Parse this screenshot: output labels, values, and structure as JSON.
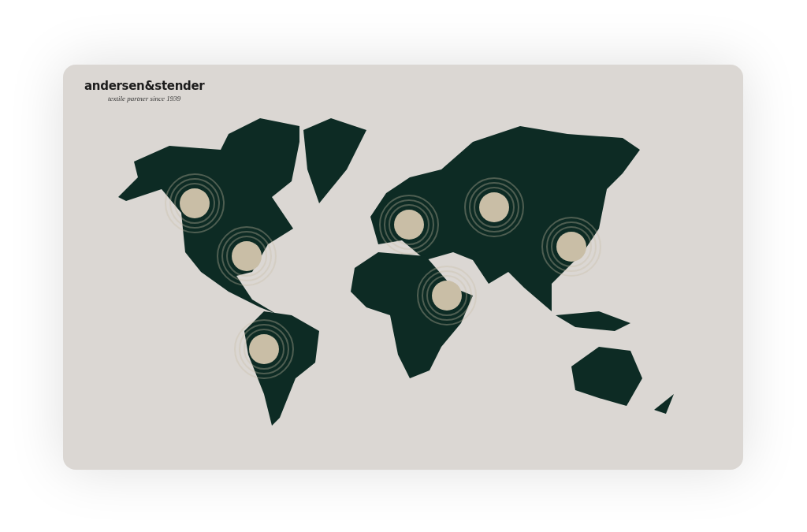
{
  "logo": {
    "wordmark": "andersen&stender",
    "tagline": "textile partner since 1939"
  }
}
